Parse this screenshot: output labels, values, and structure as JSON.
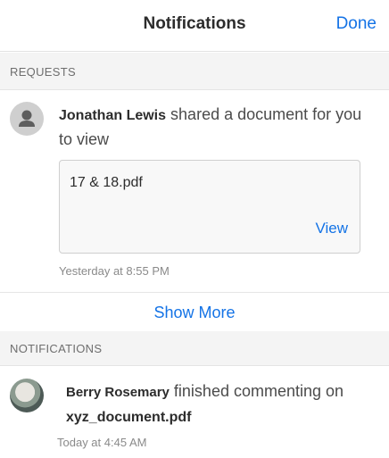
{
  "header": {
    "title": "Notifications",
    "done_label": "Done"
  },
  "requests": {
    "section_label": "REQUESTS",
    "item": {
      "user_name": "Jonathan Lewis",
      "action": "shared a document for you to view",
      "file_name": "17 & 18.pdf",
      "view_label": "View",
      "time": "Yesterday at 8:55 PM"
    },
    "show_more_label": "Show More"
  },
  "notifications": {
    "section_label": "NOTIFICATIONS",
    "item": {
      "user_name": "Berry Rosemary",
      "action": "finished commenting on",
      "document": "xyz_document.pdf",
      "time": "Today at 4:45 AM"
    }
  }
}
